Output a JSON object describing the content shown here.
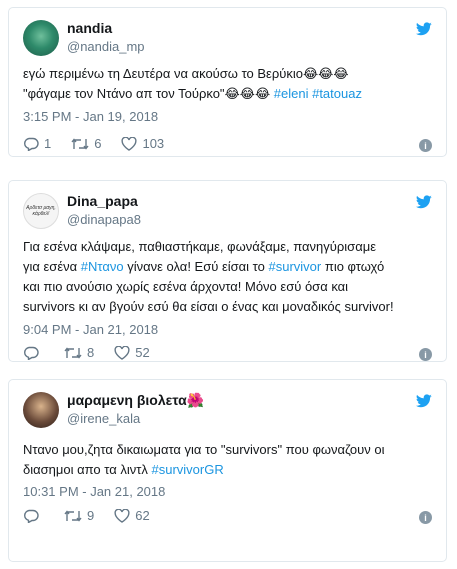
{
  "tweets": [
    {
      "name": "nandia",
      "handle": "@nandia_mp",
      "line1": "εγώ περιμένω τη Δευτέρα να ακούσω το Βερύκιο",
      "line1_emoji": "😂😂😂",
      "line2": "\"φάγαμε τον  Ντάνο απ τον Τούρκο\"",
      "line2_emoji": "😂😂😂",
      "hashtag1": "#eleni",
      "hashtag2": "#tatouaz",
      "time": "3:15 PM - Jan 19, 2018",
      "replies": "1",
      "retweets": "6",
      "likes": "103"
    },
    {
      "name": "Dina_papa",
      "handle": "@dinapapa8",
      "avatar_text": "Αρδετσ μαγη, κάρθελ!",
      "l1": "Για εσένα κλάψαμε, παθιαστήκαμε, φωνάξαμε, πανηγύρισαμε",
      "l2a": "για εσένα ",
      "l2h": "#Ντανο",
      "l2b": " γίνανε ολα! Εσύ είσαι το ",
      "l2h2": "#survivor",
      "l2c": " πιο φτωχό",
      "l3": "και πιο ανούσιο χωρίς εσένα άρχοντα!  Μόνο εσύ όσα και",
      "l4": "survivors κι αν βγούν εσύ θα είσαι ο ένας και μοναδικός survivor!",
      "time": "9:04 PM - Jan 21, 2018",
      "replies": "",
      "retweets": "8",
      "likes": "52"
    },
    {
      "name": "μαραμενη βιολετα",
      "name_emoji": "🌺",
      "handle": "@irene_kala",
      "l1": "Ντανο μου,ζητα δικαιωματα για το \"survivors\" που φωναζουν οι",
      "l2a": "διασημοι απο τα λιντλ ",
      "l2h": "#survivorGR",
      "time": "10:31 PM - Jan 21, 2018",
      "replies": "",
      "retweets": "9",
      "likes": "62"
    }
  ],
  "colors": {
    "link": "#1b95e0",
    "muted": "#657786",
    "twitter": "#1da1f2"
  },
  "icons": [
    "twitter-bird-icon",
    "reply-icon",
    "retweet-icon",
    "like-icon",
    "info-icon"
  ]
}
